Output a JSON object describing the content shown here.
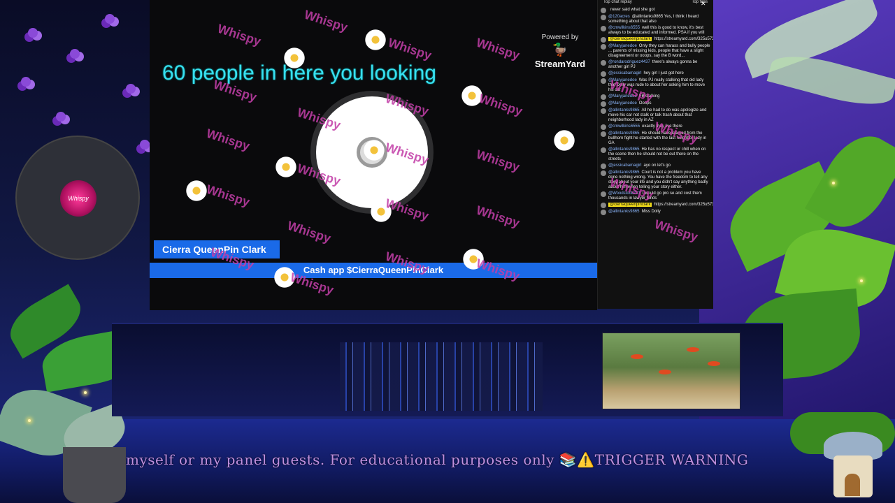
{
  "stream": {
    "title": "60 people in here you looking",
    "presenter_name": "Cierra QueenPin Clark",
    "cashapp_text": "Cash app $CierraQueenPinClark",
    "watermark": "Whispy",
    "powered_by": "Powered by",
    "brand": "StreamYard",
    "cam_label": "Whispy"
  },
  "chat": {
    "header_left": "Top chat replay",
    "header_right": "Top fans",
    "messages": [
      {
        "author": "",
        "text": "never said what she got",
        "highlight": false
      },
      {
        "author": "@120acres",
        "text": "@allintanks9865 Yes, I think I heard something about that also",
        "highlight": false
      },
      {
        "author": "@cmwilkins6555",
        "text": "well this is good to know, it's best always to be educated and informed. PSA if you will",
        "highlight": false
      },
      {
        "author": "@cierraqueenpinclark",
        "text": "https://streamyard.com/325u573fxv",
        "highlight": true
      },
      {
        "author": "@Maryjanedoe",
        "text": "Only they can harass and bully people ... parents of missing kids, people that have a slight disagreement or ooops, say the B word...",
        "highlight": false
      },
      {
        "author": "@rondarodriguez4437",
        "text": "there's always gonna be another girl PJ",
        "highlight": false
      },
      {
        "author": "@jessicabamagirl",
        "text": "hey girl I just got here",
        "highlight": false
      },
      {
        "author": "@Maryjanedoe",
        "text": "Was PJ really stalking that old lady that Dolly was rude to about her asking him to move his car",
        "highlight": false
      },
      {
        "author": "@Maryjanedoe",
        "text": "FB stalking",
        "highlight": false
      },
      {
        "author": "@Maryjanedoe",
        "text": "Ooops",
        "highlight": false
      },
      {
        "author": "@allintanks9865",
        "text": "All he had to do was apologize and move his car not stalk or talk trash about that neighborhood lady in AZ",
        "highlight": false
      },
      {
        "author": "@cmwilkins6555",
        "text": "exactly they live there",
        "highlight": false
      },
      {
        "author": "@allintanks9865",
        "text": "He should have learned from the bullhorn fight he started with the last neighbor lady in GA",
        "highlight": false
      },
      {
        "author": "@allintanks9865",
        "text": "He has no respect or chill when on the scene then he should not be out there on the streets",
        "highlight": false
      },
      {
        "author": "@jessicabamagirl",
        "text": "ayo on let's go",
        "highlight": false
      },
      {
        "author": "@allintanks9865",
        "text": "Court is not a problem you have done nothing wrong. You have the freedom to tell any story about your life and you didn't say anything badly about him when telling your story either.",
        "highlight": false
      },
      {
        "author": "@Woodstock231",
        "text": "I would go pro se and cost them thousands in lawyer funds",
        "highlight": false
      },
      {
        "author": "@cierraqueenpinclark",
        "text": "https://streamyard.com/325u573fxv",
        "highlight": true
      },
      {
        "author": "@allintanks9865",
        "text": "Miss Dolly",
        "highlight": false
      }
    ]
  },
  "ticker": {
    "text": "myself or my panel guests. For educational purposes only 📚⚠️TRIGGER WARNING"
  },
  "colors": {
    "accent_blue": "#1a6ae8",
    "title_cyan": "#38e0f0",
    "watermark_pink": "#c23ea8",
    "highlight_yellow": "#f7e11a"
  }
}
